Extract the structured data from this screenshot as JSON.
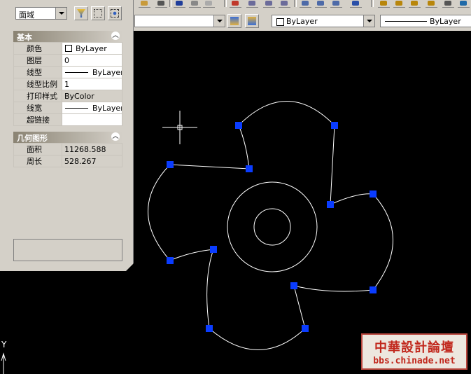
{
  "toolbar": {
    "object_type_combo": "面域",
    "color_combo": "ByLayer",
    "linetype_combo": "ByLayer"
  },
  "properties": {
    "sections": [
      {
        "title": "基本",
        "rows": [
          {
            "label": "颜色",
            "value": "ByLayer"
          },
          {
            "label": "图层",
            "value": "0"
          },
          {
            "label": "线型",
            "value": "ByLayer"
          },
          {
            "label": "线型比例",
            "value": "1"
          },
          {
            "label": "打印样式",
            "value": "ByColor"
          },
          {
            "label": "线宽",
            "value": "ByLayer"
          },
          {
            "label": "超链接",
            "value": ""
          }
        ]
      },
      {
        "title": "几何图形",
        "rows": [
          {
            "label": "面积",
            "value": "11268.588"
          },
          {
            "label": "周长",
            "value": "528.267"
          }
        ]
      }
    ]
  },
  "ucs": {
    "y_label": "Y"
  },
  "watermark": {
    "title": "中華設計論壇",
    "url": "bbs.chinade.net"
  },
  "colors": {
    "canvas": "#000000",
    "grip": "#0033ff",
    "geometry": "#ffffff",
    "panel": "#d4d0c8"
  }
}
